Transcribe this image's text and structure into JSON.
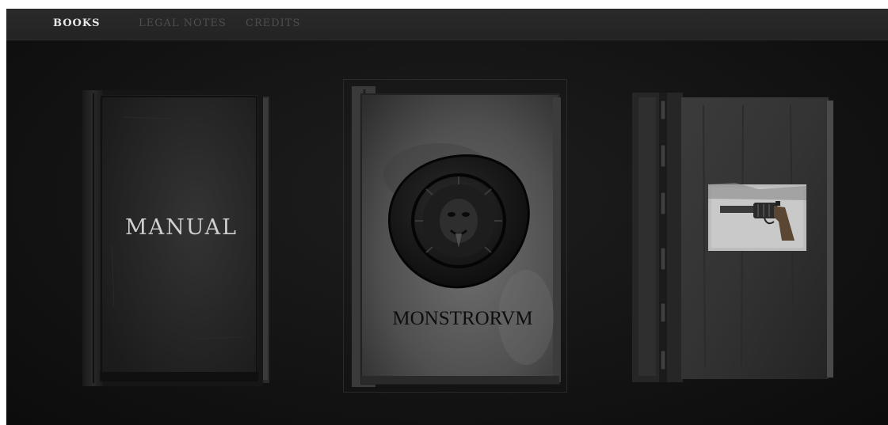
{
  "nav": {
    "tabs": [
      {
        "label": "BOOKS",
        "active": true
      },
      {
        "label": "LEGAL NOTES",
        "active": false
      },
      {
        "label": "CREDITS",
        "active": false
      }
    ]
  },
  "books": [
    {
      "title": "MANUAL",
      "cover": "plain-dark-leather"
    },
    {
      "title": "MONSTRORVM",
      "cover": "wax-seal-with-demon-face",
      "selected": true
    },
    {
      "title": "",
      "cover": "revolver-image",
      "icon": "revolver-icon"
    }
  ],
  "colors": {
    "background": "#141414",
    "topbar": "#262626",
    "active_tab": "#e8e8e8",
    "inactive_tab": "#4e4e4e"
  }
}
